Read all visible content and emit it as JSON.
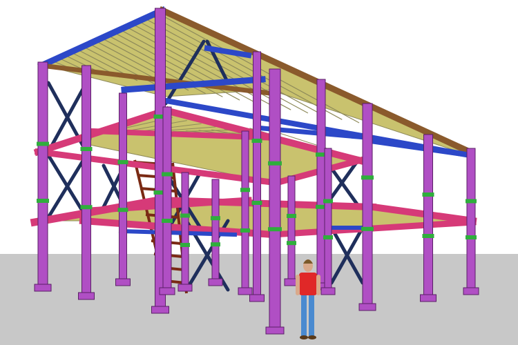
{
  "scene": {
    "subject": "steel-frame-structure",
    "colors": {
      "sky": "#ffffff",
      "ground": "#c8c8c8",
      "columns": "#b04fc4",
      "column_edge": "#5a1f66",
      "beams_floor": "#d63a78",
      "beams_roof": "#2c48c8",
      "beams_roof_edge": "#8a5a2c",
      "bracing": "#1f2f5c",
      "joists": "#c9c26e",
      "decking": "#8e8a5a",
      "stair": "#7a2a14",
      "connections": "#2fae3c",
      "person_shirt": "#e02828",
      "person_jeans": "#4a8ad0",
      "person_skin": "#d9a98a",
      "person_hair": "#7a5a2a"
    }
  }
}
